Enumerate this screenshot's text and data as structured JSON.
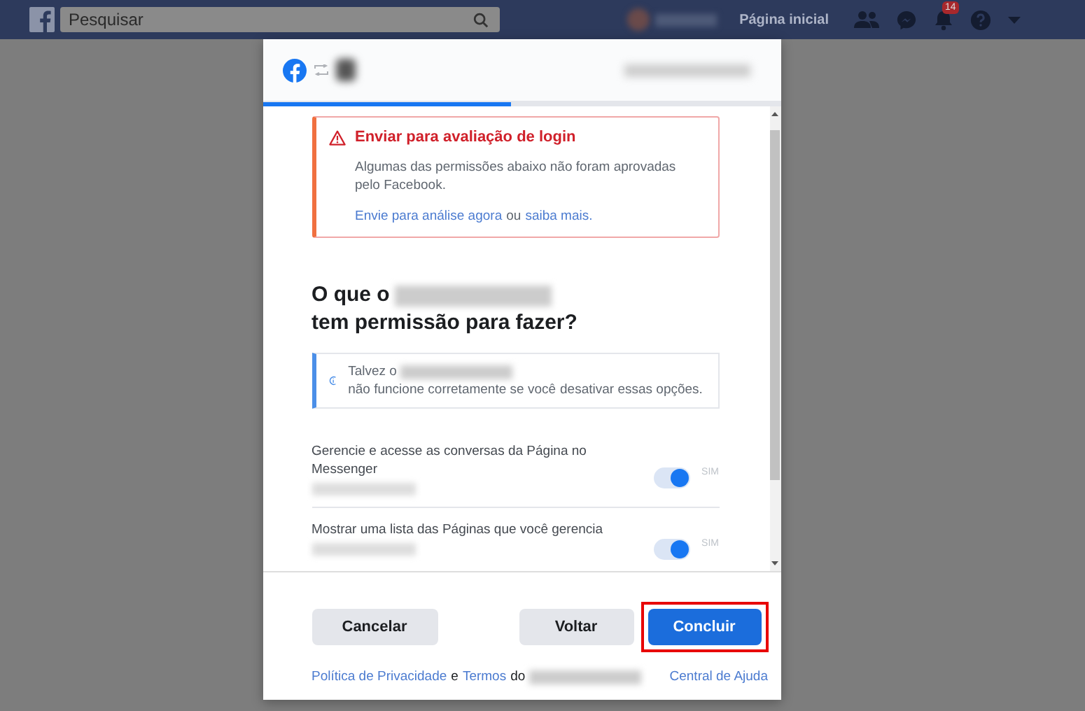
{
  "top_bar": {
    "search": {
      "placeholder": "Pesquisar"
    },
    "home_link": "Página inicial",
    "notification_count": "14"
  },
  "dialog": {
    "progress": {
      "level": 0.48
    },
    "warning": {
      "title": "Enviar para avaliação de login",
      "body": "Algumas das permissões abaixo não foram aprovadas pelo Facebook.",
      "link_review": "Envie para análise agora",
      "joiner": "ou",
      "link_learn": "saiba mais."
    },
    "heading": {
      "before": "O que o",
      "after": [
        "tem permissão para",
        "fazer?"
      ]
    },
    "info": {
      "before": "Talvez o",
      "after": [
        "não funcione corretamente se você",
        "desativar essas opções."
      ]
    },
    "permissions": [
      {
        "label": "Gerencie e acesse as conversas da Página no Messenger",
        "on": true,
        "state": "SIM"
      },
      {
        "label": "Mostrar uma lista das Páginas que você gerencia",
        "on": true,
        "state": "SIM"
      }
    ],
    "buttons": [
      {
        "label": "Cancelar",
        "kind": "secondary",
        "highlighted": false
      },
      {
        "label": "Voltar",
        "kind": "secondary",
        "highlighted": false
      },
      {
        "label": "Concluir",
        "kind": "primary",
        "highlighted": true
      }
    ],
    "footer": {
      "privacy": "Política de Privacidade",
      "and": "e",
      "terms": "Termos",
      "of": "do",
      "help": "Central de Ajuda"
    }
  }
}
